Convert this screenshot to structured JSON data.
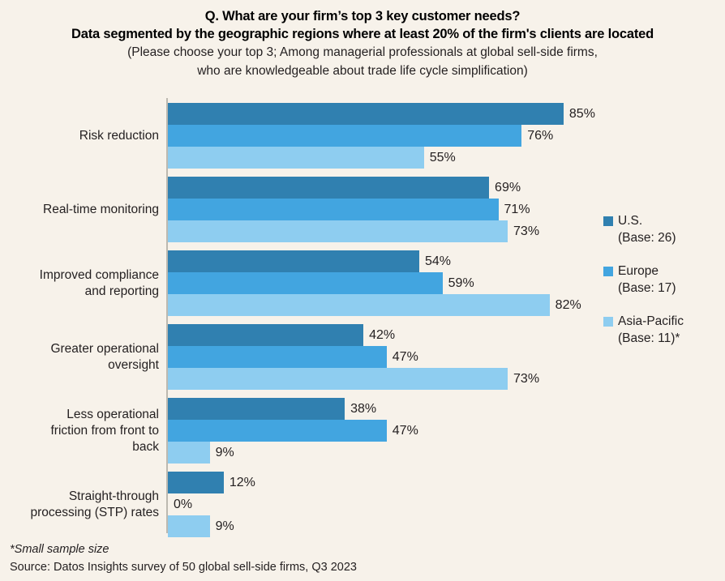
{
  "header": {
    "title_line_1": "Q. What are your firm’s top 3 key customer needs?",
    "title_line_2": "Data segmented by the geographic regions where at least 20% of the firm's clients are located",
    "subtitle_line_1": "(Please choose your top 3;  Among managerial professionals at global sell-side firms,",
    "subtitle_line_2": "who are knowledgeable about trade life cycle simplification)"
  },
  "legend": {
    "items": [
      {
        "label": "U.S.",
        "base": "(Base: 26)",
        "color": "#3080b0"
      },
      {
        "label": "Europe",
        "base": "(Base: 17)",
        "color": "#42a5e0"
      },
      {
        "label": "Asia-Pacific",
        "base": "(Base: 11)*",
        "color": "#8ecdf0"
      }
    ]
  },
  "footer": {
    "footnote": "*Small sample size",
    "source": "Source: Datos Insights survey of 50 global sell-side firms, Q3 2023"
  },
  "chart_data": {
    "type": "bar",
    "orientation": "horizontal",
    "title": "Q. What are your firm’s top 3 key customer needs? Data segmented by the geographic regions where at least 20% of the firm's clients are located",
    "xlabel": "",
    "ylabel": "",
    "xlim": [
      0,
      100
    ],
    "grid": false,
    "legend_position": "right",
    "value_suffix": "%",
    "categories": [
      "Risk reduction",
      "Real-time monitoring",
      "Improved compliance and reporting",
      "Greater operational oversight",
      "Less operational friction from front to back",
      "Straight-through processing (STP) rates"
    ],
    "category_lines": [
      [
        "Risk reduction"
      ],
      [
        "Real-time monitoring"
      ],
      [
        "Improved compliance",
        "and reporting"
      ],
      [
        "Greater operational",
        "oversight"
      ],
      [
        "Less operational",
        "friction from front to",
        "back"
      ],
      [
        "Straight-through",
        "processing (STP) rates"
      ]
    ],
    "series": [
      {
        "name": "U.S.",
        "color": "#3080b0",
        "values": [
          85,
          69,
          54,
          42,
          38,
          12
        ],
        "labels": [
          "85%",
          "69%",
          "54%",
          "42%",
          "38%",
          "12%"
        ]
      },
      {
        "name": "Europe",
        "color": "#42a5e0",
        "values": [
          76,
          71,
          59,
          47,
          47,
          0
        ],
        "labels": [
          "76%",
          "71%",
          "59%",
          "47%",
          "47%",
          "0%"
        ]
      },
      {
        "name": "Asia-Pacific",
        "color": "#8ecdf0",
        "values": [
          55,
          73,
          82,
          73,
          9,
          9
        ],
        "labels": [
          "55%",
          "73%",
          "82%",
          "73%",
          "9%",
          "9%"
        ]
      }
    ]
  }
}
